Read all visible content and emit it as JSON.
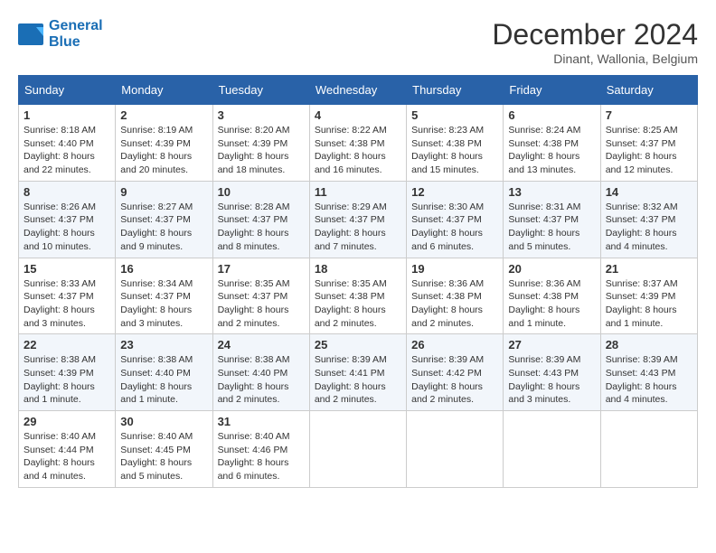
{
  "header": {
    "logo_line1": "General",
    "logo_line2": "Blue",
    "month": "December 2024",
    "location": "Dinant, Wallonia, Belgium"
  },
  "weekdays": [
    "Sunday",
    "Monday",
    "Tuesday",
    "Wednesday",
    "Thursday",
    "Friday",
    "Saturday"
  ],
  "weeks": [
    [
      {
        "day": "1",
        "sunrise": "8:18 AM",
        "sunset": "4:40 PM",
        "daylight": "8 hours and 22 minutes."
      },
      {
        "day": "2",
        "sunrise": "8:19 AM",
        "sunset": "4:39 PM",
        "daylight": "8 hours and 20 minutes."
      },
      {
        "day": "3",
        "sunrise": "8:20 AM",
        "sunset": "4:39 PM",
        "daylight": "8 hours and 18 minutes."
      },
      {
        "day": "4",
        "sunrise": "8:22 AM",
        "sunset": "4:38 PM",
        "daylight": "8 hours and 16 minutes."
      },
      {
        "day": "5",
        "sunrise": "8:23 AM",
        "sunset": "4:38 PM",
        "daylight": "8 hours and 15 minutes."
      },
      {
        "day": "6",
        "sunrise": "8:24 AM",
        "sunset": "4:38 PM",
        "daylight": "8 hours and 13 minutes."
      },
      {
        "day": "7",
        "sunrise": "8:25 AM",
        "sunset": "4:37 PM",
        "daylight": "8 hours and 12 minutes."
      }
    ],
    [
      {
        "day": "8",
        "sunrise": "8:26 AM",
        "sunset": "4:37 PM",
        "daylight": "8 hours and 10 minutes."
      },
      {
        "day": "9",
        "sunrise": "8:27 AM",
        "sunset": "4:37 PM",
        "daylight": "8 hours and 9 minutes."
      },
      {
        "day": "10",
        "sunrise": "8:28 AM",
        "sunset": "4:37 PM",
        "daylight": "8 hours and 8 minutes."
      },
      {
        "day": "11",
        "sunrise": "8:29 AM",
        "sunset": "4:37 PM",
        "daylight": "8 hours and 7 minutes."
      },
      {
        "day": "12",
        "sunrise": "8:30 AM",
        "sunset": "4:37 PM",
        "daylight": "8 hours and 6 minutes."
      },
      {
        "day": "13",
        "sunrise": "8:31 AM",
        "sunset": "4:37 PM",
        "daylight": "8 hours and 5 minutes."
      },
      {
        "day": "14",
        "sunrise": "8:32 AM",
        "sunset": "4:37 PM",
        "daylight": "8 hours and 4 minutes."
      }
    ],
    [
      {
        "day": "15",
        "sunrise": "8:33 AM",
        "sunset": "4:37 PM",
        "daylight": "8 hours and 3 minutes."
      },
      {
        "day": "16",
        "sunrise": "8:34 AM",
        "sunset": "4:37 PM",
        "daylight": "8 hours and 3 minutes."
      },
      {
        "day": "17",
        "sunrise": "8:35 AM",
        "sunset": "4:37 PM",
        "daylight": "8 hours and 2 minutes."
      },
      {
        "day": "18",
        "sunrise": "8:35 AM",
        "sunset": "4:38 PM",
        "daylight": "8 hours and 2 minutes."
      },
      {
        "day": "19",
        "sunrise": "8:36 AM",
        "sunset": "4:38 PM",
        "daylight": "8 hours and 2 minutes."
      },
      {
        "day": "20",
        "sunrise": "8:36 AM",
        "sunset": "4:38 PM",
        "daylight": "8 hours and 1 minute."
      },
      {
        "day": "21",
        "sunrise": "8:37 AM",
        "sunset": "4:39 PM",
        "daylight": "8 hours and 1 minute."
      }
    ],
    [
      {
        "day": "22",
        "sunrise": "8:38 AM",
        "sunset": "4:39 PM",
        "daylight": "8 hours and 1 minute."
      },
      {
        "day": "23",
        "sunrise": "8:38 AM",
        "sunset": "4:40 PM",
        "daylight": "8 hours and 1 minute."
      },
      {
        "day": "24",
        "sunrise": "8:38 AM",
        "sunset": "4:40 PM",
        "daylight": "8 hours and 2 minutes."
      },
      {
        "day": "25",
        "sunrise": "8:39 AM",
        "sunset": "4:41 PM",
        "daylight": "8 hours and 2 minutes."
      },
      {
        "day": "26",
        "sunrise": "8:39 AM",
        "sunset": "4:42 PM",
        "daylight": "8 hours and 2 minutes."
      },
      {
        "day": "27",
        "sunrise": "8:39 AM",
        "sunset": "4:43 PM",
        "daylight": "8 hours and 3 minutes."
      },
      {
        "day": "28",
        "sunrise": "8:39 AM",
        "sunset": "4:43 PM",
        "daylight": "8 hours and 4 minutes."
      }
    ],
    [
      {
        "day": "29",
        "sunrise": "8:40 AM",
        "sunset": "4:44 PM",
        "daylight": "8 hours and 4 minutes."
      },
      {
        "day": "30",
        "sunrise": "8:40 AM",
        "sunset": "4:45 PM",
        "daylight": "8 hours and 5 minutes."
      },
      {
        "day": "31",
        "sunrise": "8:40 AM",
        "sunset": "4:46 PM",
        "daylight": "8 hours and 6 minutes."
      },
      null,
      null,
      null,
      null
    ]
  ],
  "labels": {
    "sunrise": "Sunrise:",
    "sunset": "Sunset:",
    "daylight": "Daylight:"
  }
}
